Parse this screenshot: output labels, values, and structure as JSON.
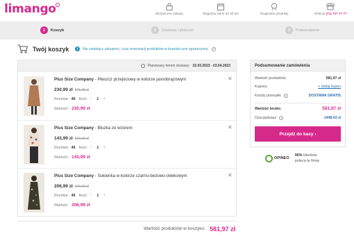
{
  "header": {
    "logo": "limango",
    "features": [
      {
        "label": "Bezpieczne zakupy",
        "icon": "lock-icon"
      },
      {
        "label": "Wygodny zwrot do 30 dni",
        "icon": "calendar-icon"
      },
      {
        "label": "Oryginalne produkty",
        "icon": "badge-icon"
      },
      {
        "label": "Infolinia",
        "icon": "phone-icon"
      }
    ],
    "phone": "(71) 727 77 77"
  },
  "steps": [
    {
      "num": "1",
      "label": "Koszyk",
      "active": true
    },
    {
      "num": "2",
      "label": "Dostawa i płatność",
      "active": false
    },
    {
      "num": "3",
      "label": "Potwierdzenie",
      "active": false
    }
  ],
  "cart": {
    "title": "Twój koszyk",
    "notice": "Nie zwlekaj z zakupem, czas rezerwacji produktów w koszyku jest ograniczony.",
    "delivery_label": "Planowany termin dostawy:",
    "delivery_dates": "22.03.2023 - 03.04.2023",
    "size_label": "Rozmiar:",
    "qty_label": "Ilość:",
    "value_label": "Wartość:",
    "total_label": "Wartość produktów w koszyku:",
    "total_value": "581,97 zł",
    "items": [
      {
        "brand": "Plus Size Company",
        "name": " - Płaszcz przejściowy w kolorze jasnobrązowym",
        "price": "230,99 zł",
        "old_price": "871,20 zł",
        "size": "46",
        "qty": "1",
        "value": "230,99 zł"
      },
      {
        "brand": "Plus Size Company",
        "name": " - Bluzka ze wzorem",
        "price": "143,99 zł",
        "old_price": "523,20 zł",
        "size": "46",
        "qty": "1",
        "value": "143,99 zł"
      },
      {
        "brand": "Plus Size Company",
        "name": " - Sukienka w kolorze czarno-beżowo-oliwkowym",
        "price": "206,99 zł",
        "old_price": "696,00 zł",
        "size": "46",
        "qty": "1",
        "value": "206,99 zł"
      }
    ]
  },
  "summary": {
    "title": "Podsumowanie zamówienia",
    "products_label": "Wartość produktów:",
    "products_value": "581,97 zł",
    "coupons_label": "Kupony:",
    "coupons_link": "+ dodaj kupon",
    "shipping_label": "Koszty przesyłki:",
    "shipping_value": "DOSTAWA GRATIS",
    "brutto_label": "Wartość brutto:",
    "brutto_value": "581,97 zł",
    "savings_label": "Oszczędzasz:",
    "savings_value": "1448,43 zł",
    "checkout_label": "Przejdź do kasy ›"
  },
  "opineo": {
    "logo": "OPINEO",
    "percent": "96%",
    "text1": "klientów",
    "text2": "poleca tę firmę"
  },
  "colors": {
    "accent": "#d62a8a",
    "link": "#2a6fb5",
    "info": "#2a8fb5"
  }
}
